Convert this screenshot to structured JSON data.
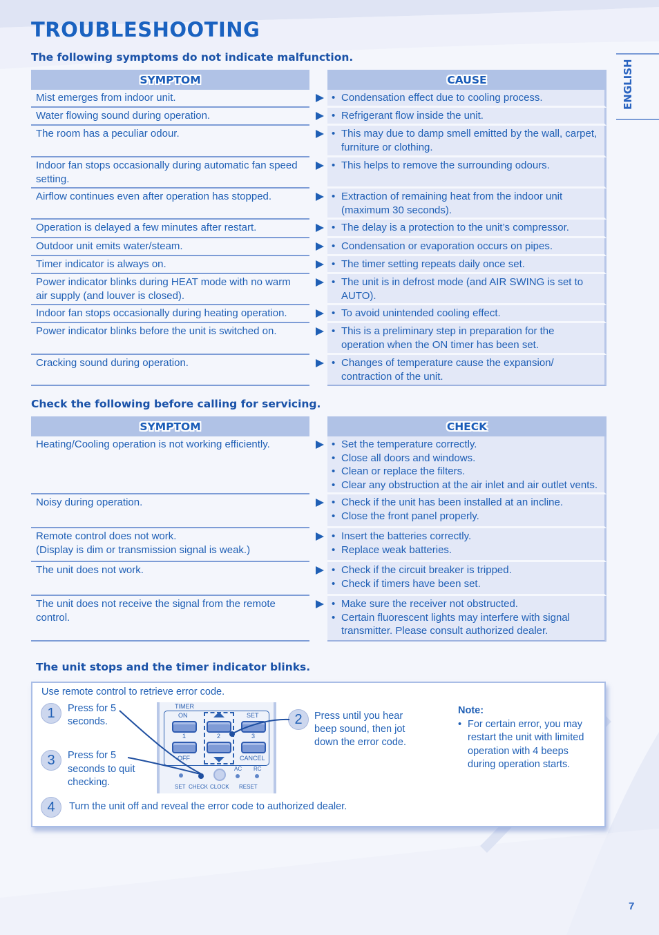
{
  "page": {
    "title": "TROUBLESHOOTING",
    "language_tab": "ENGLISH",
    "page_number": "7",
    "colors": {
      "accent": "#1f5fb5",
      "header_fill": "#b0c2e6",
      "cause_fill": "#e3e8f7"
    }
  },
  "section1": {
    "heading": "The following symptoms do not indicate malfunction.",
    "col_symptom": "SYMPTOM",
    "col_cause": "CAUSE",
    "rows": [
      {
        "symptom": "Mist emerges from indoor unit.",
        "causes": [
          "Condensation effect due to cooling process."
        ]
      },
      {
        "symptom": "Water flowing sound during operation.",
        "causes": [
          "Refrigerant flow inside the unit."
        ]
      },
      {
        "symptom": "The room has a peculiar odour.",
        "causes": [
          "This may due to damp smell emitted by the wall, carpet, furniture or clothing."
        ]
      },
      {
        "symptom": "Indoor fan stops occasionally during automatic fan speed setting.",
        "causes": [
          "This helps to remove the surrounding odours."
        ]
      },
      {
        "symptom": "Airflow continues even after operation has stopped.",
        "causes": [
          "Extraction of remaining heat from the indoor unit (maximum 30 seconds)."
        ]
      },
      {
        "symptom": "Operation is delayed a few minutes after restart.",
        "causes": [
          "The delay is a protection to the unit’s compressor."
        ]
      },
      {
        "symptom": "Outdoor unit emits water/steam.",
        "causes": [
          "Condensation or evaporation occurs on pipes."
        ]
      },
      {
        "symptom": "Timer indicator is always on.",
        "causes": [
          "The timer setting repeats daily once set."
        ]
      },
      {
        "symptom": "Power indicator blinks during HEAT mode with no warm air supply (and louver is closed).",
        "causes": [
          "The unit is in defrost mode (and AIR SWING is set to AUTO)."
        ]
      },
      {
        "symptom": "Indoor fan stops occasionally during heating operation.",
        "causes": [
          "To avoid unintended cooling effect."
        ]
      },
      {
        "symptom": "Power indicator blinks before the unit is switched on.",
        "causes": [
          "This is a preliminary step in preparation for the operation when the ON timer has been set."
        ]
      },
      {
        "symptom": "Cracking sound during operation.",
        "causes": [
          "Changes of temperature cause the expansion/ contraction of the unit."
        ]
      }
    ]
  },
  "section2": {
    "heading": "Check the following before calling for servicing.",
    "col_symptom": "SYMPTOM",
    "col_check": "CHECK",
    "rows": [
      {
        "symptom": "Heating/Cooling operation is not working efficiently.",
        "checks": [
          "Set the temperature correctly.",
          "Close all doors and windows.",
          "Clean or replace the filters.",
          "Clear any obstruction at the air inlet and air outlet vents."
        ]
      },
      {
        "symptom": "Noisy during operation.",
        "checks": [
          "Check if the unit has been installed at an incline.",
          "Close the front panel properly."
        ]
      },
      {
        "symptom": "Remote control does not work.\n(Display is dim or transmission signal is weak.)",
        "checks": [
          "Insert the batteries correctly.",
          "Replace weak batteries."
        ]
      },
      {
        "symptom": "The unit does not work.",
        "checks": [
          "Check if the circuit breaker is tripped.",
          "Check if timers have been set."
        ]
      },
      {
        "symptom": "The unit does not receive the signal from the remote control.",
        "checks": [
          "Make sure the receiver not obstructed.",
          "Certain fluorescent lights may interfere with signal transmitter. Please consult authorized dealer."
        ]
      }
    ]
  },
  "section3": {
    "heading": "The unit stops and the timer indicator blinks.",
    "intro": "Use remote control to retrieve error code.",
    "steps": [
      {
        "num": "1",
        "text": "Press for 5 seconds."
      },
      {
        "num": "2",
        "text": "Press until you hear beep sound, then jot down the error code."
      },
      {
        "num": "3",
        "text": "Press for 5 seconds to quit checking."
      },
      {
        "num": "4",
        "text": "Turn the unit off and reveal the error code to authorized dealer."
      }
    ],
    "note": {
      "title": "Note:",
      "items": [
        "For certain error, you may restart the unit with limited operation with 4 beeps during operation starts."
      ]
    },
    "remote": {
      "timer": "TIMER",
      "on": "ON",
      "set": "SET",
      "off": "OFF",
      "cancel": "CANCEL",
      "n1": "1",
      "n2": "2",
      "n3": "3",
      "ac": "AC",
      "rc": "RC",
      "set_label": "SET",
      "check": "CHECK",
      "clock": "CLOCK",
      "reset": "RESET"
    }
  }
}
